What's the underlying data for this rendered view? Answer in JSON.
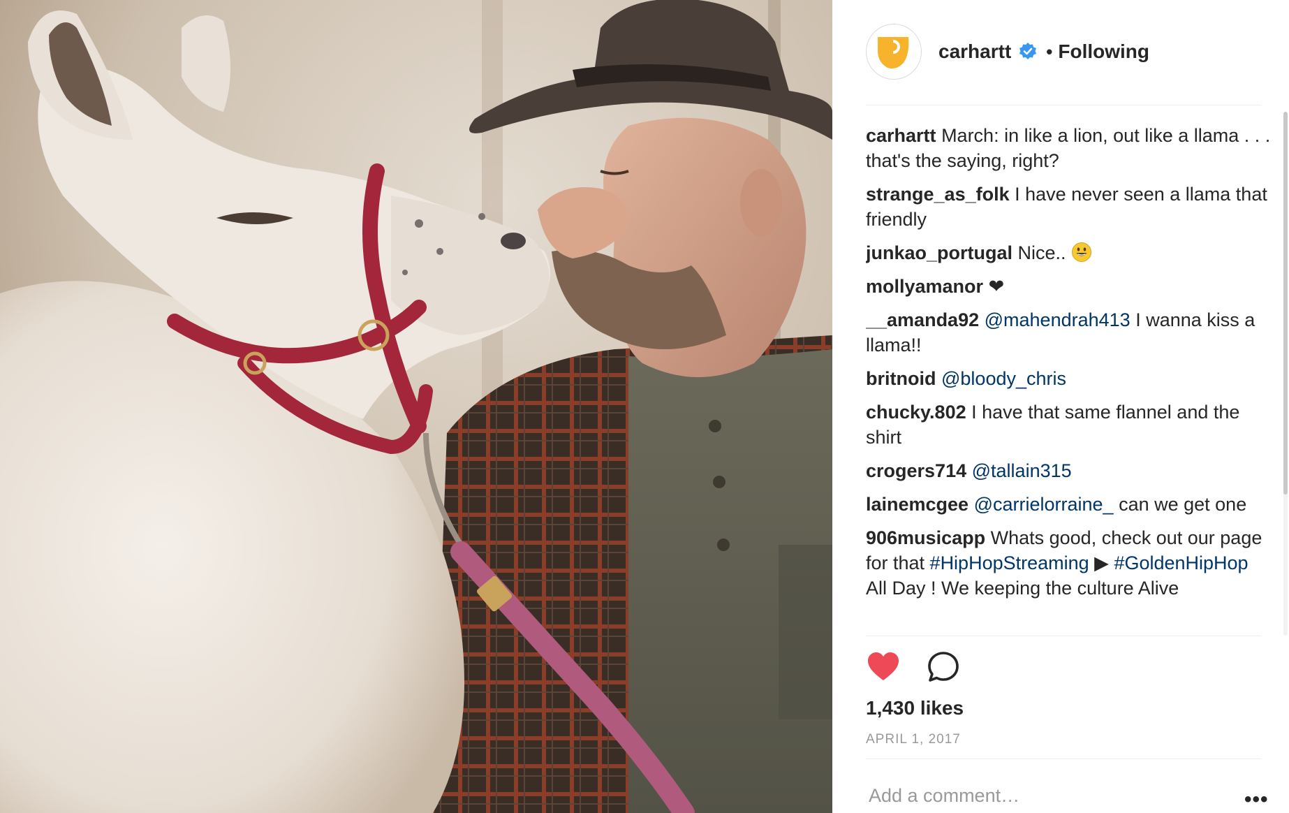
{
  "post": {
    "username": "carhartt",
    "follow_status": "Following",
    "separator": "•",
    "likes": "1,430 likes",
    "date": "APRIL 1, 2017",
    "add_comment_placeholder": "Add a comment…",
    "more": "•••"
  },
  "comments": [
    {
      "user": "carhartt",
      "parts": [
        {
          "t": "text",
          "v": "March: in like a lion, out like a llama . . . that's the saying, right?"
        }
      ]
    },
    {
      "user": "strange_as_folk",
      "parts": [
        {
          "t": "text",
          "v": "I have never seen a llama that friendly"
        }
      ]
    },
    {
      "user": "junkao_portugal",
      "parts": [
        {
          "t": "text",
          "v": "Nice.. "
        },
        {
          "t": "emoji",
          "v": "smiley-emoji"
        }
      ]
    },
    {
      "user": "mollyamanor",
      "parts": [
        {
          "t": "heart",
          "v": "❤"
        }
      ]
    },
    {
      "user": "__amanda92",
      "parts": [
        {
          "t": "mention",
          "v": "@mahendrah413"
        },
        {
          "t": "text",
          "v": " I wanna kiss a llama!!"
        }
      ]
    },
    {
      "user": "britnoid",
      "parts": [
        {
          "t": "mention",
          "v": "@bloody_chris"
        }
      ]
    },
    {
      "user": "chucky.802",
      "parts": [
        {
          "t": "text",
          "v": "I have that same flannel and the shirt"
        }
      ]
    },
    {
      "user": "crogers714",
      "parts": [
        {
          "t": "mention",
          "v": "@tallain315"
        }
      ]
    },
    {
      "user": "lainemcgee",
      "parts": [
        {
          "t": "mention",
          "v": "@carrielorraine_"
        },
        {
          "t": "text",
          "v": " can we get one"
        }
      ]
    },
    {
      "user": "906musicapp",
      "parts": [
        {
          "t": "text",
          "v": "Whats good, check out our page for that "
        },
        {
          "t": "mention",
          "v": "#HipHopStreaming"
        },
        {
          "t": "text",
          "v": " ▶ "
        },
        {
          "t": "mention",
          "v": "#GoldenHipHop"
        },
        {
          "t": "text",
          "v": " All Day ! We keeping the culture Alive"
        }
      ]
    }
  ],
  "colors": {
    "brand_yellow": "#f6b32b",
    "verified_blue": "#3897f0",
    "like_red": "#ed4956",
    "mention_blue": "#003569"
  },
  "icons": {
    "like": "heart-filled-icon",
    "comment": "speech-bubble-icon",
    "verified": "verified-badge-icon"
  }
}
